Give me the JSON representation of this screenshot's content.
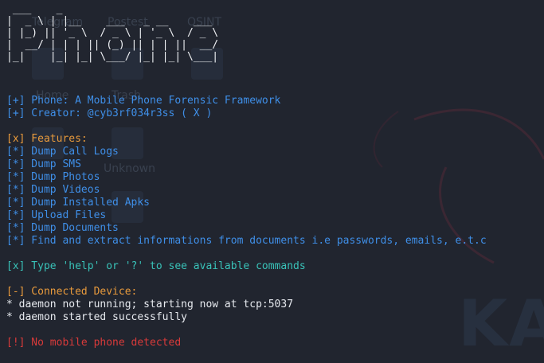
{
  "colors": {
    "background": "#21252f",
    "info": "#3f8fe8",
    "section": "#e89a3c",
    "hint": "#39c2b8",
    "error": "#d93a3a",
    "plain": "#e6e9ee"
  },
  "desktop_background": {
    "labels": [
      "Telegram",
      "Postest",
      "OSINT",
      "Home",
      "Trash",
      "Unknown"
    ],
    "watermark": "KA"
  },
  "terminal": {
    "ascii_logo": [
      "  ___   _",
      " | _ \\ | |_   ___  _ _   ___",
      " |  _/ | ' \\ / _ \\| ' \\ / -_)",
      " |_|   |_||_|\\___/|_||_|\\___|"
    ],
    "ascii_logo_full": " ___    _\n|  _ \\ | |__    ___   _ __    ___\n| |_) || '_ \\  / _ \\ | '_ \\  / _ \\\n|  __/ | | | || (_) || | | ||  __/\n|_|    |_| |_| \\___/ |_| |_| \\___|",
    "intro": [
      "[+] Phone: A Mobile Phone Forensic Framework",
      "[+] Creator: @cyb3rf034r3ss ( X )"
    ],
    "features_heading": "[x] Features:",
    "features": [
      "[*] Dump Call Logs",
      "[*] Dump SMS",
      "[*] Dump Photos",
      "[*] Dump Videos",
      "[*] Dump Installed Apks",
      "[*] Upload Files",
      "[*] Dump Documents",
      "[*] Find and extract informations from documents i.e passwords, emails, e.t.c"
    ],
    "help_hint": "[x] Type 'help' or '?' to see available commands",
    "connected_heading": "[-] Connected Device:",
    "daemon_lines": [
      "* daemon not running; starting now at tcp:5037",
      "* daemon started successfully"
    ],
    "error_line": "[!] No mobile phone detected"
  }
}
